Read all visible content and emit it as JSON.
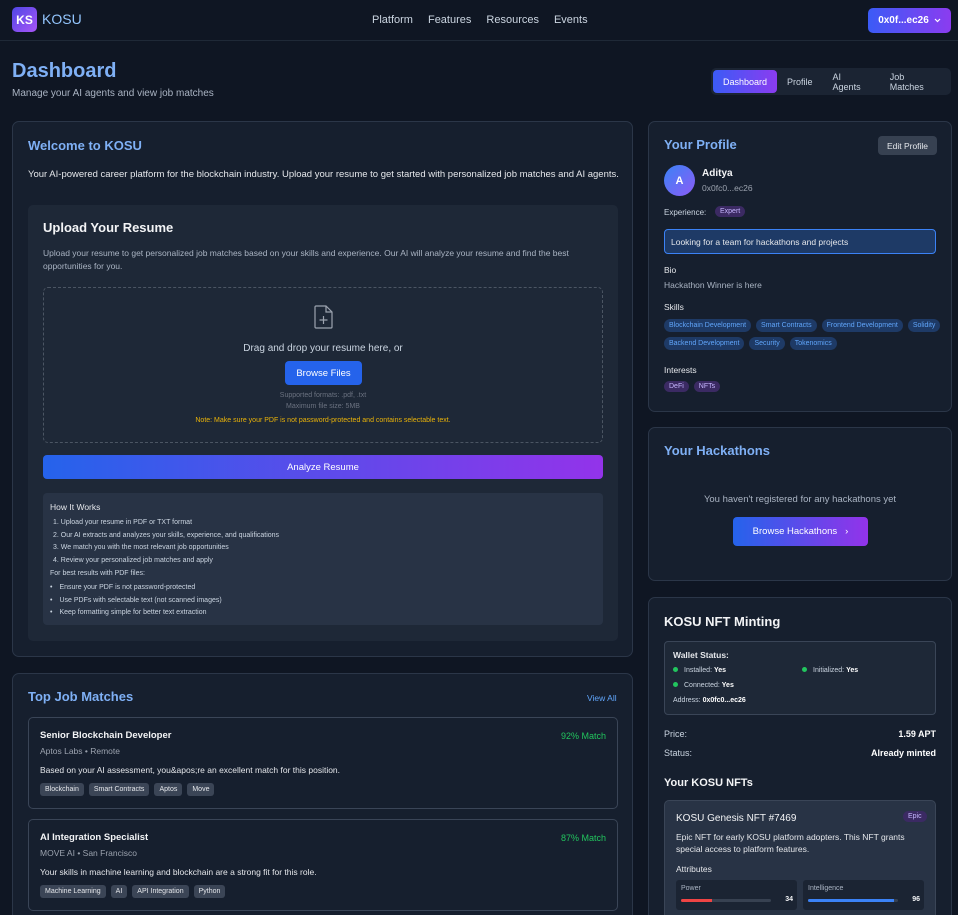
{
  "nav": {
    "logo_mark": "KS",
    "brand": "KOSU",
    "links": [
      "Platform",
      "Features",
      "Resources",
      "Events"
    ],
    "wallet_label": "0x0f...ec26"
  },
  "header": {
    "title": "Dashboard",
    "subtitle": "Manage your AI agents and view job matches",
    "tabs": [
      "Dashboard",
      "Profile",
      "AI Agents",
      "Job Matches"
    ]
  },
  "welcome": {
    "title": "Welcome to KOSU",
    "text": "Your AI-powered career platform for the blockchain industry. Upload your resume to get started with personalized job matches and AI agents.",
    "upload": {
      "title": "Upload Your Resume",
      "description": "Upload your resume to get personalized job matches based on your skills and experience. Our AI will analyze your resume and find the best opportunities for you.",
      "drop_text": "Drag and drop your resume here, or",
      "browse_label": "Browse Files",
      "formats": "Supported formats: .pdf, .txt",
      "max_size": "Maximum file size: 5MB",
      "note": "Note: Make sure your PDF is not password-protected and contains selectable text.",
      "analyze_label": "Analyze Resume"
    },
    "how": {
      "title": "How It Works",
      "steps": [
        "1. Upload your resume in PDF or TXT format",
        "2. Our AI extracts and analyzes your skills, experience, and qualifications",
        "3. We match you with the most relevant job opportunities",
        "4. Review your personalized job matches and apply"
      ],
      "best_title": "For best results with PDF files:",
      "bullets": [
        "Ensure your PDF is not password-protected",
        "Use PDFs with selectable text (not scanned images)",
        "Keep formatting simple for better text extraction"
      ]
    }
  },
  "jobs": {
    "title": "Top Job Matches",
    "view_all": "View All",
    "items": [
      {
        "title": "Senior Blockchain Developer",
        "match": "92% Match",
        "company": "Aptos Labs • Remote",
        "desc": "Based on your AI assessment, you&apos;re an excellent match for this position.",
        "tags": [
          "Blockchain",
          "Smart Contracts",
          "Aptos",
          "Move"
        ]
      },
      {
        "title": "AI Integration Specialist",
        "match": "87% Match",
        "company": "MOVE AI • San Francisco",
        "desc": "Your skills in machine learning and blockchain are a strong fit for this role.",
        "tags": [
          "Machine Learning",
          "AI",
          "API Integration",
          "Python"
        ]
      }
    ]
  },
  "profile": {
    "title": "Your Profile",
    "edit_label": "Edit Profile",
    "avatar_letter": "A",
    "name": "Aditya",
    "address": "0x0fc0...ec26",
    "experience_label": "Experience:",
    "experience": "Expert",
    "looking": "Looking for a team for hackathons and projects",
    "bio_label": "Bio",
    "bio": "Hackathon Winner is here",
    "skills_label": "Skills",
    "skills": [
      "Blockchain Development",
      "Smart Contracts",
      "Frontend Development",
      "Solidity",
      "Backend Development",
      "Security",
      "Tokenomics"
    ],
    "interests_label": "Interests",
    "interests": [
      "DeFi",
      "NFTs"
    ]
  },
  "hackathons": {
    "title": "Your Hackathons",
    "empty": "You haven't registered for any hackathons yet",
    "browse_label": "Browse Hackathons",
    "arrow": "›"
  },
  "nft": {
    "title": "KOSU NFT Minting",
    "wallet_status": {
      "title": "Wallet Status:",
      "installed_label": "Installed:",
      "installed": "Yes",
      "initialized_label": "Initialized:",
      "initialized": "Yes",
      "connected_label": "Connected:",
      "connected": "Yes",
      "address_label": "Address:",
      "address": "0x0fc0...ec26"
    },
    "price_label": "Price:",
    "price": "1.59 APT",
    "status_label": "Status:",
    "status": "Already minted",
    "your_nfts": "Your KOSU NFTs",
    "card": {
      "name": "KOSU Genesis NFT #7469",
      "rarity": "Epic",
      "desc": "Epic NFT for early KOSU platform adopters. This NFT grants special access to platform features.",
      "attributes_label": "Attributes",
      "attributes": [
        {
          "name": "Power",
          "value": "34",
          "level": 34,
          "color": "#ef4444"
        },
        {
          "name": "Intelligence",
          "value": "96",
          "level": 96,
          "color": "#3b82f6"
        }
      ]
    }
  },
  "colors": {
    "accent_blue": "#2563eb",
    "accent_purple": "#9333ea",
    "match_green": "#22c55e",
    "note_yellow": "#eab308"
  }
}
